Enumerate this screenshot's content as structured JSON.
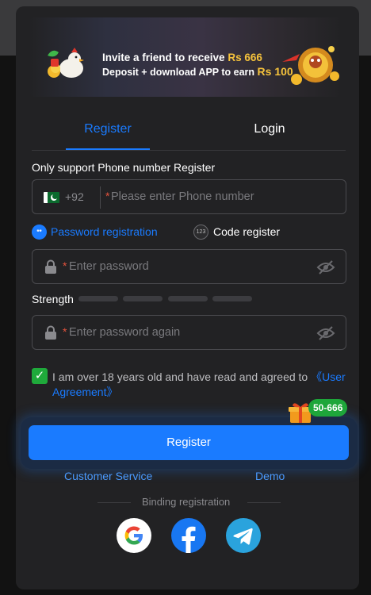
{
  "banner": {
    "line1_prefix": "Invite a friend to receive",
    "line1_amount": "Rs 666",
    "line2_prefix": "Deposit + download APP to earn",
    "line2_amount": "Rs 100"
  },
  "tabs": [
    {
      "label": "Register",
      "active": true
    },
    {
      "label": "Login",
      "active": false
    }
  ],
  "form": {
    "subheading": "Only support Phone number Register",
    "phone": {
      "country_code": "+92",
      "required_mark": "*",
      "placeholder": "Please enter Phone number",
      "value": ""
    },
    "modes": {
      "password_label": "Password registration",
      "password_icon_text": "**",
      "code_label": "Code register",
      "code_icon_text": "123"
    },
    "password": {
      "required_mark": "*",
      "placeholder": "Enter password",
      "value": ""
    },
    "strength": {
      "label": "Strength",
      "segments": 4,
      "filled": 0
    },
    "confirm_password": {
      "required_mark": "*",
      "placeholder": "Enter password again",
      "value": ""
    },
    "agreement": {
      "checked": true,
      "checkmark": "✓",
      "text": "I am over 18 years old and have read and agreed to ",
      "link_text": "《User Agreement》"
    },
    "promo_badge": "50-666",
    "submit_label": "Register"
  },
  "links": {
    "customer_service": "Customer Service",
    "demo": "Demo"
  },
  "binding": {
    "label": "Binding registration",
    "providers": [
      "google-icon",
      "facebook-icon",
      "telegram-icon"
    ]
  },
  "colors": {
    "accent": "#1a7bff",
    "success": "#1faa3b",
    "required": "#e5533d",
    "surface": "#222224"
  }
}
